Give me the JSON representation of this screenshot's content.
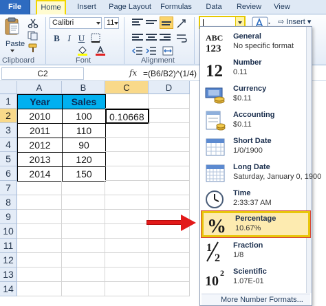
{
  "ribbon_tabs": {
    "file": "File",
    "home": "Home",
    "insert": "Insert",
    "page_layout": "Page Layout",
    "formulas": "Formulas",
    "data": "Data",
    "review": "Review",
    "view": "View"
  },
  "ribbon": {
    "paste_label": "Paste",
    "font_name": "Calibri",
    "font_size": "11",
    "bold": "B",
    "italic": "I",
    "underline": "U",
    "insert_label": "Insert",
    "groups": {
      "clipboard": "Clipboard",
      "font": "Font",
      "alignment": "Alignment"
    },
    "number_format_value": ""
  },
  "formula_bar": {
    "name_box": "C2",
    "fx_label": "fx",
    "formula": "=(B6/B2)^(1/4)"
  },
  "grid": {
    "columns": [
      "A",
      "B",
      "C",
      "D"
    ],
    "rows": [
      "1",
      "2",
      "3",
      "4",
      "5",
      "6",
      "7",
      "8",
      "9",
      "10",
      "11",
      "12",
      "13",
      "14"
    ],
    "header": {
      "year": "Year",
      "sales": "Sales"
    },
    "data": [
      {
        "year": "2010",
        "sales": "100"
      },
      {
        "year": "2011",
        "sales": "110"
      },
      {
        "year": "2012",
        "sales": "90"
      },
      {
        "year": "2013",
        "sales": "120"
      },
      {
        "year": "2014",
        "sales": "150"
      }
    ],
    "c2_value": "0.10668"
  },
  "number_formats": {
    "items": [
      {
        "title": "General",
        "sample": "No specific format",
        "icon": "abc-123-icon"
      },
      {
        "title": "Number",
        "sample": "0.11",
        "icon": "number-12-icon"
      },
      {
        "title": "Currency",
        "sample": "$0.11",
        "icon": "currency-icon"
      },
      {
        "title": "Accounting",
        "sample": "$0.11",
        "icon": "accounting-icon"
      },
      {
        "title": "Short Date",
        "sample": "1/0/1900",
        "icon": "calendar-short-icon"
      },
      {
        "title": "Long Date",
        "sample": "Saturday, January 0, 1900",
        "icon": "calendar-long-icon"
      },
      {
        "title": "Time",
        "sample": "2:33:37 AM",
        "icon": "clock-icon"
      },
      {
        "title": "Percentage",
        "sample": "10.67%",
        "icon": "percent-icon"
      },
      {
        "title": "Fraction",
        "sample": "1/8",
        "icon": "fraction-icon"
      },
      {
        "title": "Scientific",
        "sample": "1.07E-01",
        "icon": "scientific-icon"
      }
    ],
    "highlighted": "Percentage",
    "more_formats": "More Number Formats...",
    "abc_glyph": "ABC",
    "num_glyph": "123",
    "twelve_glyph": "12",
    "percent_glyph": "%",
    "half_num": "1",
    "half_den": "2",
    "sci_base": "10",
    "sci_exp": "2"
  },
  "colors": {
    "header_fill": "#00b0f0",
    "highlight_fill": "#fdebb0",
    "highlight_border": "#e8c60a",
    "arrow": "#e21a1a"
  }
}
